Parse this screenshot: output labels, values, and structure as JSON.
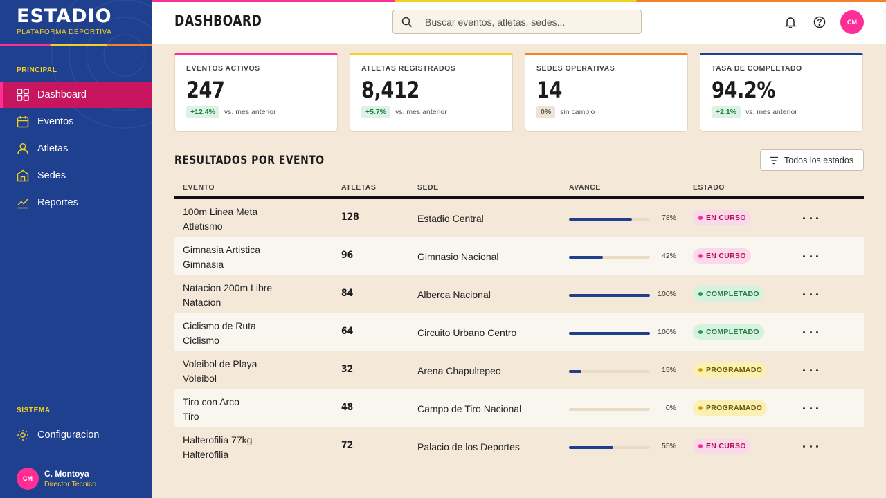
{
  "brand": {
    "title": "ESTADIO",
    "subtitle": "PLATAFORMA DEPORTIVA"
  },
  "sidebar": {
    "principal_label": "PRINCIPAL",
    "items": [
      {
        "label": "Dashboard",
        "icon": "grid-icon",
        "active": true
      },
      {
        "label": "Eventos",
        "icon": "calendar-icon"
      },
      {
        "label": "Atletas",
        "icon": "user-icon"
      },
      {
        "label": "Sedes",
        "icon": "building-icon"
      },
      {
        "label": "Reportes",
        "icon": "chart-line-icon"
      }
    ],
    "sistema_label": "SISTEMA",
    "config_label": "Configuracion"
  },
  "user": {
    "initials": "CM",
    "name": "C. Montoya",
    "role": "Director Tecnico"
  },
  "header": {
    "title": "DASHBOARD",
    "search_placeholder": "Buscar eventos, atletas, sedes...",
    "avatar_initials": "CM"
  },
  "stats": [
    {
      "label": "EVENTOS ACTIVOS",
      "value": "247",
      "change": "+12.4%",
      "note": "vs. mes anterior",
      "color": "#ff2e97",
      "trend": "up"
    },
    {
      "label": "ATLETAS REGISTRADOS",
      "value": "8,412",
      "change": "+5.7%",
      "note": "vs. mes anterior",
      "color": "#f5d020",
      "trend": "up"
    },
    {
      "label": "SEDES OPERATIVAS",
      "value": "14",
      "change": "0%",
      "note": "sin cambio",
      "color": "#f5802a",
      "trend": "flat"
    },
    {
      "label": "TASA DE COMPLETADO",
      "value": "94.2%",
      "change": "+2.1%",
      "note": "vs. mes anterior",
      "color": "#1f3f8f",
      "trend": "up"
    }
  ],
  "results": {
    "title": "RESULTADOS POR EVENTO",
    "filter_label": "Todos los estados",
    "columns": [
      "EVENTO",
      "ATLETAS",
      "SEDE",
      "AVANCE",
      "ESTADO"
    ],
    "rows": [
      {
        "event": "100m Linea Meta",
        "sport": "Atletismo",
        "athletes": "128",
        "venue": "Estadio Central",
        "progress": 78,
        "progress_label": "78%",
        "status": "EN CURSO",
        "status_kind": "curso"
      },
      {
        "event": "Gimnasia Artistica",
        "sport": "Gimnasia",
        "athletes": "96",
        "venue": "Gimnasio Nacional",
        "progress": 42,
        "progress_label": "42%",
        "status": "EN CURSO",
        "status_kind": "curso"
      },
      {
        "event": "Natacion 200m Libre",
        "sport": "Natacion",
        "athletes": "84",
        "venue": "Alberca Nacional",
        "progress": 100,
        "progress_label": "100%",
        "status": "COMPLETADO",
        "status_kind": "comp"
      },
      {
        "event": "Ciclismo de Ruta",
        "sport": "Ciclismo",
        "athletes": "64",
        "venue": "Circuito Urbano Centro",
        "progress": 100,
        "progress_label": "100%",
        "status": "COMPLETADO",
        "status_kind": "comp"
      },
      {
        "event": "Voleibol de Playa",
        "sport": "Voleibol",
        "athletes": "32",
        "venue": "Arena Chapultepec",
        "progress": 15,
        "progress_label": "15%",
        "status": "PROGRAMADO",
        "status_kind": "prog"
      },
      {
        "event": "Tiro con Arco",
        "sport": "Tiro",
        "athletes": "48",
        "venue": "Campo de Tiro Nacional",
        "progress": 0,
        "progress_label": "0%",
        "status": "PROGRAMADO",
        "status_kind": "prog"
      },
      {
        "event": "Halterofilia 77kg",
        "sport": "Halterofilia",
        "athletes": "72",
        "venue": "Palacio de los Deportes",
        "progress": 55,
        "progress_label": "55%",
        "status": "EN CURSO",
        "status_kind": "curso"
      }
    ]
  }
}
